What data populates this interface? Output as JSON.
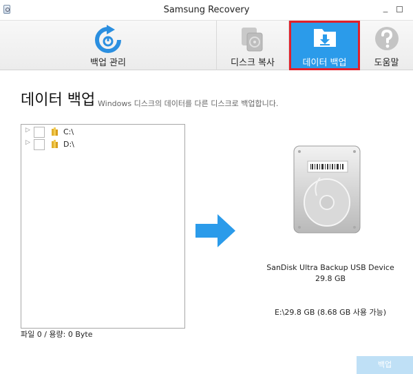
{
  "window": {
    "title": "Samsung Recovery"
  },
  "toolbar": {
    "manage_label": "백업 관리",
    "copy_label": "디스크 복사",
    "backup_label": "데이터 백업",
    "help_label": "도움말",
    "active_tab": "데이터 백업",
    "active_color": "#2b9bea",
    "highlight_color": "#e2202a"
  },
  "page": {
    "title": "데이터 백업",
    "subtitle": "Windows 디스크의 데이터를 다른 디스크로 백업합니다."
  },
  "tree": {
    "items": [
      {
        "label": "C:\\",
        "checked": false
      },
      {
        "label": "D:\\",
        "checked": false
      }
    ]
  },
  "file_info": "파일 0 / 용량: 0 Byte",
  "target": {
    "device_name": "SanDisk Ultra Backup USB Device",
    "device_size": "29.8 GB",
    "volume_info": "E:\\29.8 GB (8.68 GB 사용 가능)"
  },
  "actions": {
    "backup_label": "백업"
  },
  "icons": {
    "manage": "backup-manage-icon",
    "copy": "disk-copy-icon",
    "backup": "folder-download-icon",
    "help": "help-icon",
    "arrow": "arrow-right-icon",
    "drive": "hard-drive-icon"
  }
}
